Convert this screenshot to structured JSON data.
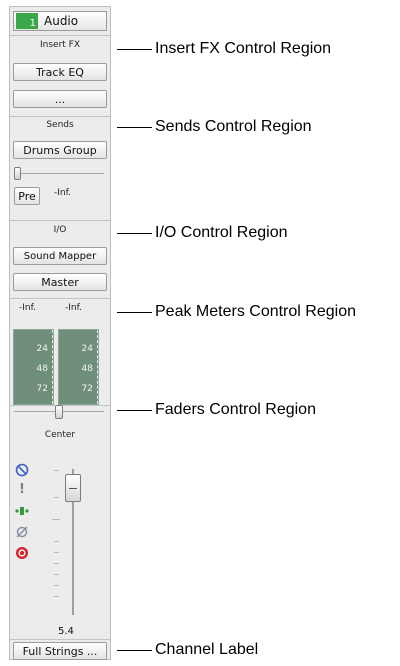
{
  "channel": {
    "track_number": "1",
    "track_name": "Audio",
    "insert_fx": {
      "header": "Insert FX",
      "slot1": "Track EQ",
      "slot2": "..."
    },
    "sends": {
      "header": "Sends",
      "send_target": "Drums Group",
      "pre_button": "Pre",
      "level": "-Inf."
    },
    "io": {
      "header": "I/O",
      "input": "Sound Mapper",
      "output": "Master"
    },
    "peak": {
      "left": "-Inf.",
      "right": "-Inf.",
      "ticks": [
        "24",
        "48",
        "72"
      ]
    },
    "fader": {
      "pan_label": "Center",
      "value": "5.4"
    },
    "label": "Full Strings ..."
  },
  "callouts": {
    "insert_fx": "Insert FX Control Region",
    "sends": "Sends Control Region",
    "io": "I/O Control Region",
    "peak_meters": "Peak Meters Control Region",
    "faders": "Faders Control Region",
    "channel_label": "Channel Label"
  },
  "colors": {
    "meter": "#6f8f7b",
    "track_badge": "#3aa84a",
    "mute": "#3a5fc8",
    "record": "#d3232b"
  },
  "icons": [
    "mute-icon",
    "solo-icon",
    "input-echo-icon",
    "phase-icon",
    "record-arm-icon"
  ]
}
